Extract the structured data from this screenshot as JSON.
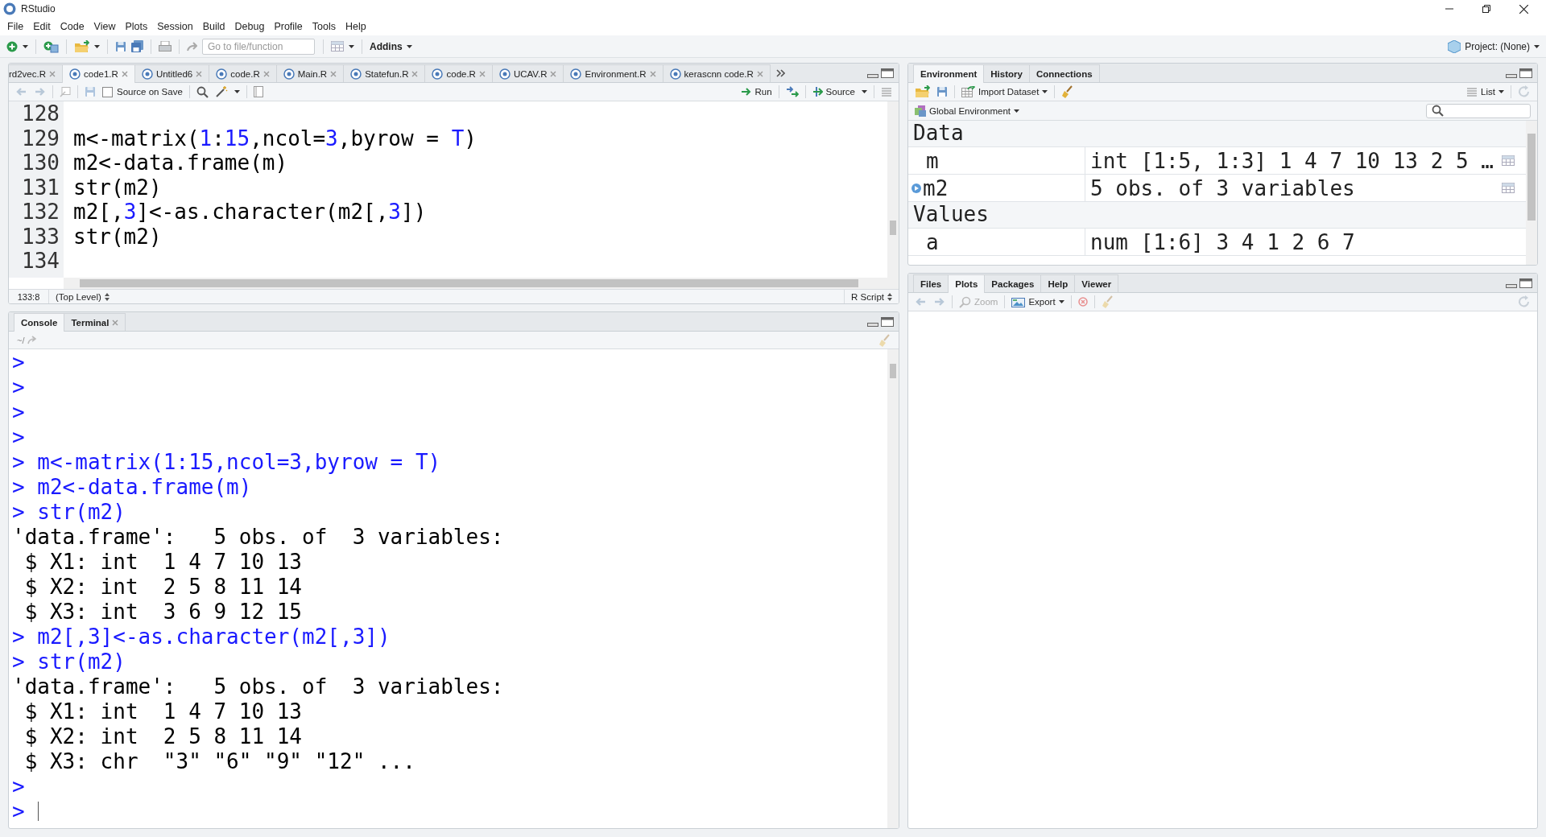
{
  "window": {
    "title": "RStudio"
  },
  "menu": [
    "File",
    "Edit",
    "Code",
    "View",
    "Plots",
    "Session",
    "Build",
    "Debug",
    "Profile",
    "Tools",
    "Help"
  ],
  "main_toolbar": {
    "goto_placeholder": "Go to file/function",
    "addins": "Addins",
    "project": "Project: (None)"
  },
  "editor": {
    "tabs": [
      {
        "label": "rd2vec.R",
        "selected": false
      },
      {
        "label": "code1.R",
        "selected": true
      },
      {
        "label": "Untitled6",
        "selected": false
      },
      {
        "label": "code.R",
        "selected": false
      },
      {
        "label": "Main.R",
        "selected": false
      },
      {
        "label": "Statefun.R",
        "selected": false
      },
      {
        "label": "code.R",
        "selected": false
      },
      {
        "label": "UCAV.R",
        "selected": false
      },
      {
        "label": "Environment.R",
        "selected": false
      },
      {
        "label": "kerascnn code.R",
        "selected": false
      }
    ],
    "source_on_save": {
      "label": "Source on Save",
      "checked": false
    },
    "run": "Run",
    "source": "Source",
    "lines": [
      {
        "number": "128"
      },
      {
        "number": "129",
        "code": "m<-matrix(1:15,ncol=3,byrow = T)"
      },
      {
        "number": "130",
        "code": "m2<-data.frame(m)"
      },
      {
        "number": "131",
        "code": "str(m2)"
      },
      {
        "number": "132",
        "code": "m2[,3]<-as.character(m2[,3])"
      },
      {
        "number": "133",
        "code": "str(m2)"
      },
      {
        "number": "134"
      }
    ],
    "cursor": "133:8",
    "scope": "(Top Level)",
    "file_type": "R Script"
  },
  "console": {
    "tabs": [
      {
        "label": "Console",
        "selected": true,
        "closable": false
      },
      {
        "label": "Terminal",
        "selected": false,
        "closable": true
      }
    ],
    "path": "~/",
    "lines": [
      {
        "kind": "input",
        "text": ">"
      },
      {
        "kind": "input",
        "text": ">"
      },
      {
        "kind": "input",
        "text": ">"
      },
      {
        "kind": "input",
        "text": ">"
      },
      {
        "kind": "input",
        "text": "> m<-matrix(1:15,ncol=3,byrow = T)"
      },
      {
        "kind": "input",
        "text": "> m2<-data.frame(m)"
      },
      {
        "kind": "input",
        "text": "> str(m2)"
      },
      {
        "kind": "output",
        "text": "'data.frame':   5 obs. of  3 variables:"
      },
      {
        "kind": "output",
        "text": " $ X1: int  1 4 7 10 13"
      },
      {
        "kind": "output",
        "text": " $ X2: int  2 5 8 11 14"
      },
      {
        "kind": "output",
        "text": " $ X3: int  3 6 9 12 15"
      },
      {
        "kind": "input",
        "text": "> m2[,3]<-as.character(m2[,3])"
      },
      {
        "kind": "input",
        "text": "> str(m2)"
      },
      {
        "kind": "output",
        "text": "'data.frame':   5 obs. of  3 variables:"
      },
      {
        "kind": "output",
        "text": " $ X1: int  1 4 7 10 13"
      },
      {
        "kind": "output",
        "text": " $ X2: int  2 5 8 11 14"
      },
      {
        "kind": "output",
        "text": " $ X3: chr  \"3\" \"6\" \"9\" \"12\" ..."
      },
      {
        "kind": "input",
        "text": ">"
      },
      {
        "kind": "prompt",
        "text": ">"
      }
    ]
  },
  "environment": {
    "tabs": [
      {
        "label": "Environment",
        "selected": true
      },
      {
        "label": "History",
        "selected": false
      },
      {
        "label": "Connections",
        "selected": false
      }
    ],
    "import": "Import Dataset",
    "view": "List",
    "scope": "Global Environment",
    "sections": [
      {
        "title": "Data",
        "rows": [
          {
            "name": "m",
            "value": "int [1:5, 1:3] 1 4 7 10 13 2 5 …",
            "expandable": false,
            "viewable": true
          },
          {
            "name": "m2",
            "value": "5 obs. of 3 variables",
            "expandable": true,
            "viewable": true
          }
        ]
      },
      {
        "title": "Values",
        "rows": [
          {
            "name": "a",
            "value": "num [1:6] 3 4 1 2 6 7",
            "expandable": false,
            "viewable": false
          }
        ]
      }
    ]
  },
  "files": {
    "tabs": [
      {
        "label": "Files",
        "selected": false
      },
      {
        "label": "Plots",
        "selected": true
      },
      {
        "label": "Packages",
        "selected": false
      },
      {
        "label": "Help",
        "selected": false
      },
      {
        "label": "Viewer",
        "selected": false
      }
    ],
    "zoom": "Zoom",
    "export": "Export"
  }
}
